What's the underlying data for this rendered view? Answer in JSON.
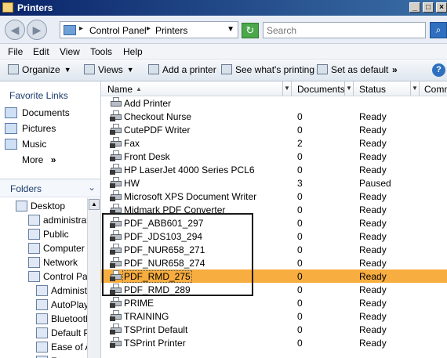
{
  "window": {
    "title": "Printers"
  },
  "address": {
    "crumbs": [
      "Control Panel",
      "Printers"
    ],
    "separator": "▸"
  },
  "search": {
    "placeholder": "Search"
  },
  "menu": [
    "File",
    "Edit",
    "View",
    "Tools",
    "Help"
  ],
  "toolbar": {
    "organize": "Organize",
    "views": "Views",
    "add_printer": "Add a printer",
    "see_printing": "See what's printing",
    "set_default": "Set as default",
    "more": "»"
  },
  "favorites": {
    "header": "Favorite Links",
    "items": [
      "Documents",
      "Pictures",
      "Music"
    ],
    "more": "More"
  },
  "folders": {
    "header": "Folders",
    "tree": [
      "Desktop",
      "administrator",
      "Public",
      "Computer",
      "Network",
      "Control Panel",
      "Administra",
      "AutoPlay",
      "Bluetooth",
      "Default Pr",
      "Ease of Ac",
      "Fo"
    ]
  },
  "columns": {
    "name": "Name",
    "documents": "Documents",
    "status": "Status",
    "comments": "Comm"
  },
  "printers": [
    {
      "name": "Add Printer",
      "documents": "",
      "status": ""
    },
    {
      "name": "Checkout Nurse",
      "documents": "0",
      "status": "Ready"
    },
    {
      "name": "CutePDF Writer",
      "documents": "0",
      "status": "Ready"
    },
    {
      "name": "Fax",
      "documents": "2",
      "status": "Ready"
    },
    {
      "name": "Front Desk",
      "documents": "0",
      "status": "Ready"
    },
    {
      "name": "HP LaserJet 4000 Series PCL6",
      "documents": "0",
      "status": "Ready"
    },
    {
      "name": "HW",
      "documents": "3",
      "status": "Paused"
    },
    {
      "name": "Microsoft XPS Document Writer",
      "documents": "0",
      "status": "Ready"
    },
    {
      "name": "Midmark PDF Converter",
      "documents": "0",
      "status": "Ready"
    },
    {
      "name": "PDF_ABB601_297",
      "documents": "0",
      "status": "Ready"
    },
    {
      "name": "PDF_JDS103_294",
      "documents": "0",
      "status": "Ready"
    },
    {
      "name": "PDF_NUR658_271",
      "documents": "0",
      "status": "Ready"
    },
    {
      "name": "PDF_NUR658_274",
      "documents": "0",
      "status": "Ready"
    },
    {
      "name": "PDF_RMD_275",
      "documents": "0",
      "status": "Ready",
      "selected": true
    },
    {
      "name": "PDF_RMD_289",
      "documents": "0",
      "status": "Ready"
    },
    {
      "name": "PRIME",
      "documents": "0",
      "status": "Ready"
    },
    {
      "name": "TRAINING",
      "documents": "0",
      "status": "Ready"
    },
    {
      "name": "TSPrint Default",
      "documents": "0",
      "status": "Ready"
    },
    {
      "name": "TSPrint Printer",
      "documents": "0",
      "status": "Ready"
    }
  ],
  "colors": {
    "selection": "#f7ad3f",
    "titlebar": "#0a246a"
  }
}
